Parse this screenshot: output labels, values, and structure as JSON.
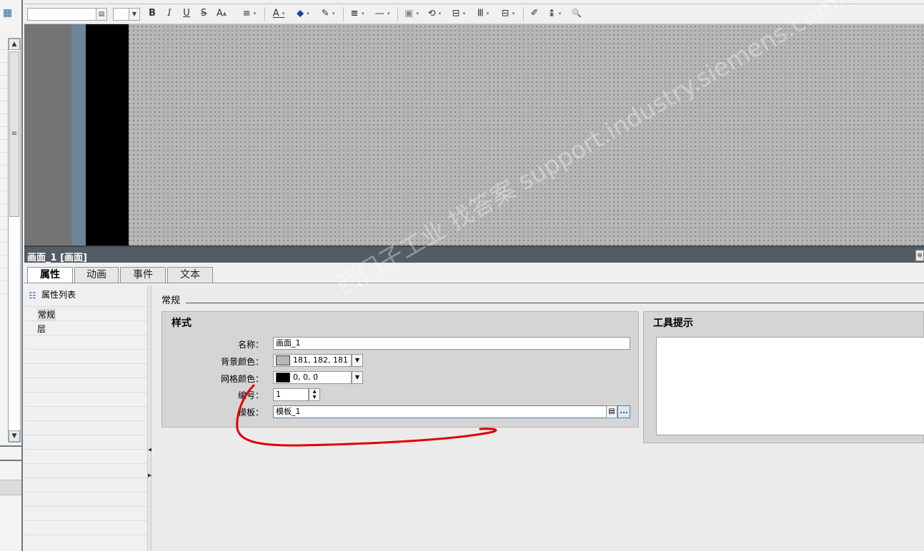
{
  "toolbar": {
    "font_dropdown_glyph": "▤",
    "size_dropdown_glyph": "▼",
    "bold": "B",
    "italic": "I",
    "underline": "U",
    "strike": "S",
    "font_size_up": "A",
    "align": "≡",
    "text_color": "A",
    "fill_color": "◆",
    "line_color": "✎",
    "line_weight": "≡",
    "line_style": "—",
    "arrange": "▣",
    "rotate": "⟲",
    "align_objects": "⊟",
    "distribute": "Ⅲ",
    "same_size": "⊟",
    "pipette": "✐",
    "sort": "↨",
    "zoom": "🔍",
    "dropdown_marker": "▾"
  },
  "inspector": {
    "title": "画面_1 [画面]",
    "corner_glyph": "⊖",
    "tabs": [
      "属性",
      "动画",
      "事件",
      "文本"
    ],
    "nav": {
      "header": "属性列表",
      "items": [
        "常规",
        "层"
      ]
    },
    "section": "常规",
    "style_group": {
      "title": "样式",
      "name_label": "名称：",
      "name_value": "画面_1",
      "bg_color_label": "背景颜色：",
      "bg_color_value": "181, 182, 181",
      "bg_color_hex": "#b5b6b5",
      "grid_color_label": "网格颜色：",
      "grid_color_value": "0, 0, 0",
      "grid_color_hex": "#000000",
      "number_label": "编号：",
      "number_value": "1",
      "template_label": "模板：",
      "template_value": "模板_1",
      "template_list_glyph": "▤",
      "template_more_glyph": "..."
    },
    "tooltip_group": {
      "title": "工具提示"
    }
  },
  "watermark": "西门子工业 找答案 support.industry.siemens.com/cs",
  "colors": {
    "accent": "#545d66",
    "annotation": "#e00000"
  }
}
